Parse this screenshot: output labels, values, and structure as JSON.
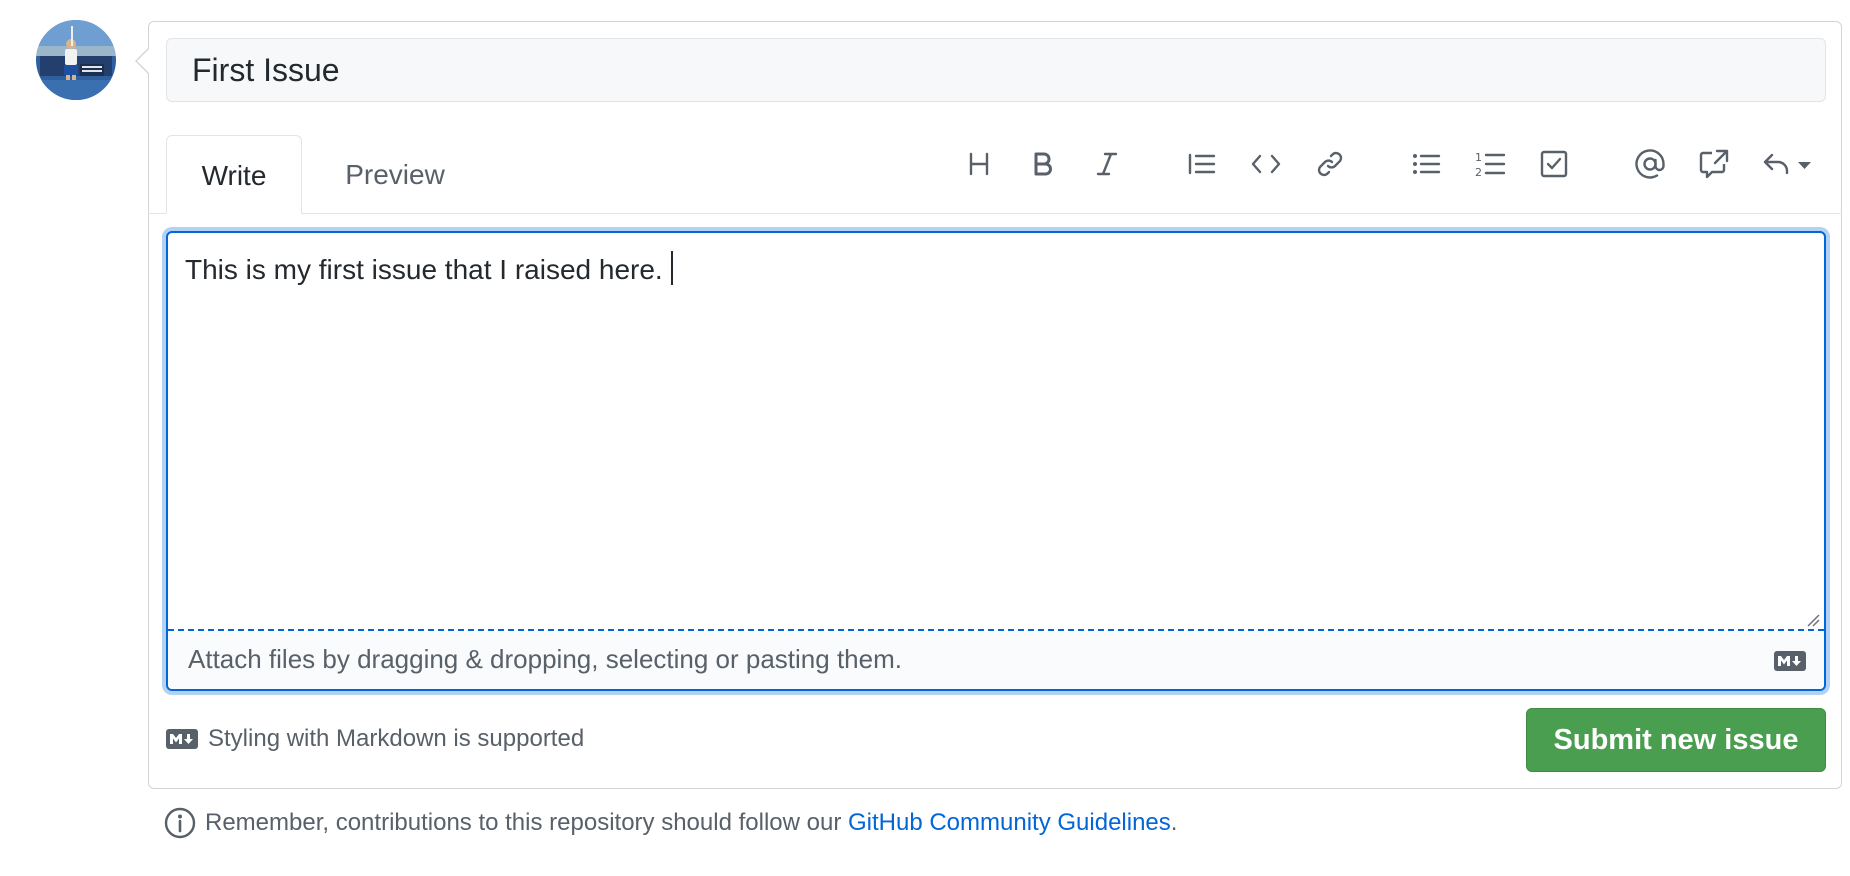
{
  "issue": {
    "title_value": "First Issue"
  },
  "tabs": [
    {
      "label": "Write",
      "active": true
    },
    {
      "label": "Preview",
      "active": false
    }
  ],
  "toolbar": {
    "icons": [
      "heading-icon",
      "bold-icon",
      "italic-icon",
      "quote-icon",
      "code-icon",
      "link-icon",
      "unordered-list-icon",
      "ordered-list-icon",
      "task-list-icon",
      "mention-icon",
      "cross-reference-icon",
      "saved-reply-icon"
    ]
  },
  "editor": {
    "value": "This is my first issue that I raised here.",
    "attach_hint": "Attach files by dragging & dropping, selecting or pasting them."
  },
  "markdown_note": "Styling with Markdown is supported",
  "submit_label": "Submit new issue",
  "footer": {
    "text_before": "Remember, contributions to this repository should follow our ",
    "link_text": "GitHub Community Guidelines",
    "text_after": "."
  },
  "colors": {
    "accent_blue": "#0366d6",
    "submit_green": "#4a9e4f",
    "border": "#d1d5da"
  }
}
